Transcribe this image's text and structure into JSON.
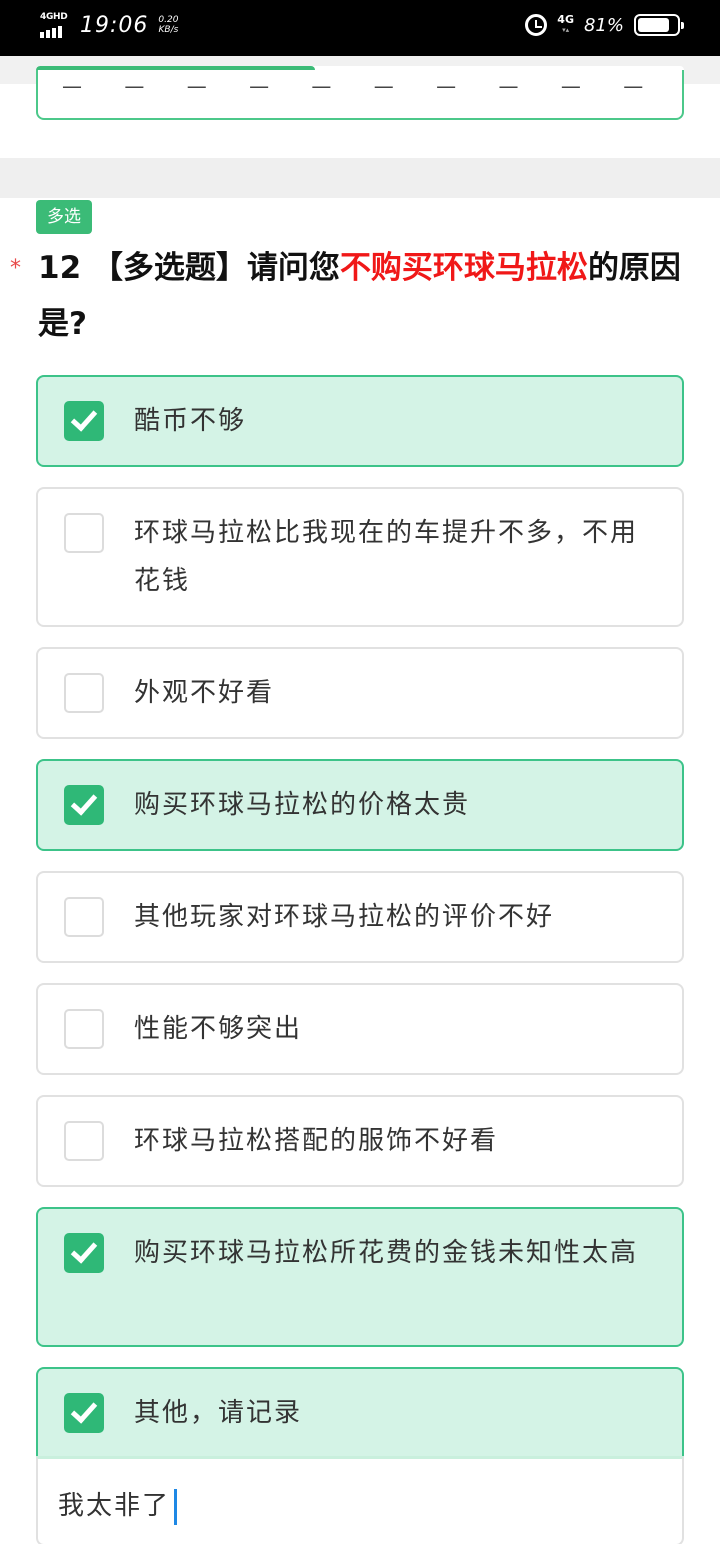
{
  "status_bar": {
    "network": "4GHD",
    "time": "19:06",
    "speed_value": "0.20",
    "speed_unit": "KB/s",
    "mobile": "4G",
    "battery": "81%",
    "battery_level": 0.81
  },
  "progress": {
    "fraction": 0.43
  },
  "question": {
    "tag": "多选",
    "number": "12",
    "type_label": "【多选题】",
    "prefix": "请问您",
    "highlight": "不购买环球马拉松",
    "suffix": "的原因是?",
    "required_mark": "*"
  },
  "options": [
    {
      "label": "酷币不够",
      "checked": true
    },
    {
      "label": "环球马拉松比我现在的车提升不多，不用花钱",
      "checked": false
    },
    {
      "label": "外观不好看",
      "checked": false
    },
    {
      "label": "购买环球马拉松的价格太贵",
      "checked": true
    },
    {
      "label": "其他玩家对环球马拉松的评价不好",
      "checked": false
    },
    {
      "label": "性能不够突出",
      "checked": false
    },
    {
      "label": "环球马拉松搭配的服饰不好看",
      "checked": false
    },
    {
      "label": "购买环球马拉松所花费的金钱未知性太高",
      "checked": true
    },
    {
      "label": "其他，请记录",
      "checked": true
    }
  ],
  "other_input": {
    "value": "我太非了"
  },
  "colors": {
    "accent": "#3bbb77",
    "checked_bg": "#d4f3e6",
    "highlight": "#f01818"
  }
}
